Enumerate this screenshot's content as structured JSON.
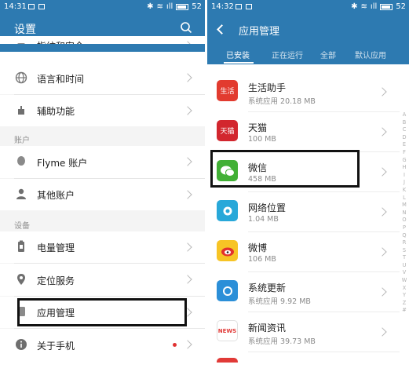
{
  "left": {
    "status": {
      "time": "14:31",
      "battery": "52"
    },
    "title": "设置",
    "rows": [
      {
        "label": "指纹和安全",
        "icon": "fingerprint-icon"
      },
      {
        "label": "语言和时间",
        "icon": "globe-icon"
      },
      {
        "label": "辅助功能",
        "icon": "hand-icon"
      },
      {
        "label": "Flyme 账户",
        "icon": "flyme-icon"
      },
      {
        "label": "其他账户",
        "icon": "person-icon"
      },
      {
        "label": "电量管理",
        "icon": "battery-icon"
      },
      {
        "label": "定位服务",
        "icon": "location-pin-icon"
      },
      {
        "label": "应用管理",
        "icon": "apps-icon"
      },
      {
        "label": "关于手机",
        "icon": "info-icon"
      }
    ],
    "sections": {
      "accounts": "账户",
      "device": "设备"
    }
  },
  "right": {
    "status": {
      "time": "14:32",
      "battery": "52"
    },
    "title": "应用管理",
    "tabs": [
      "已安装",
      "正在运行",
      "全部",
      "默认应用"
    ],
    "apps": [
      {
        "name": "生活助手",
        "meta": "系统应用   20.18 MB",
        "icon_text": "生活",
        "color": "#e23b2f"
      },
      {
        "name": "天猫",
        "meta": "100 MB",
        "icon_text": "天猫",
        "color": "#d2262e"
      },
      {
        "name": "微信",
        "meta": "458 MB",
        "icon_text": "",
        "color": "#41b035"
      },
      {
        "name": "网络位置",
        "meta": "1.04 MB",
        "icon_text": "",
        "color": "#28a8d9"
      },
      {
        "name": "微博",
        "meta": "106 MB",
        "icon_text": "",
        "color": "#f7c425"
      },
      {
        "name": "系统更新",
        "meta": "系统应用   9.92 MB",
        "icon_text": "",
        "color": "#2b8fd8"
      },
      {
        "name": "新闻资讯",
        "meta": "系统应用   39.73 MB",
        "icon_text": "NEWS",
        "color": "#e13a37"
      }
    ],
    "alphabet": [
      "A",
      "B",
      "C",
      "D",
      "E",
      "F",
      "G",
      "H",
      "I",
      "J",
      "K",
      "L",
      "M",
      "N",
      "O",
      "P",
      "Q",
      "R",
      "S",
      "T",
      "U",
      "V",
      "W",
      "X",
      "Y",
      "Z",
      "#"
    ]
  },
  "colors": {
    "header": "#2d7ab1",
    "highlight": "#111111"
  }
}
